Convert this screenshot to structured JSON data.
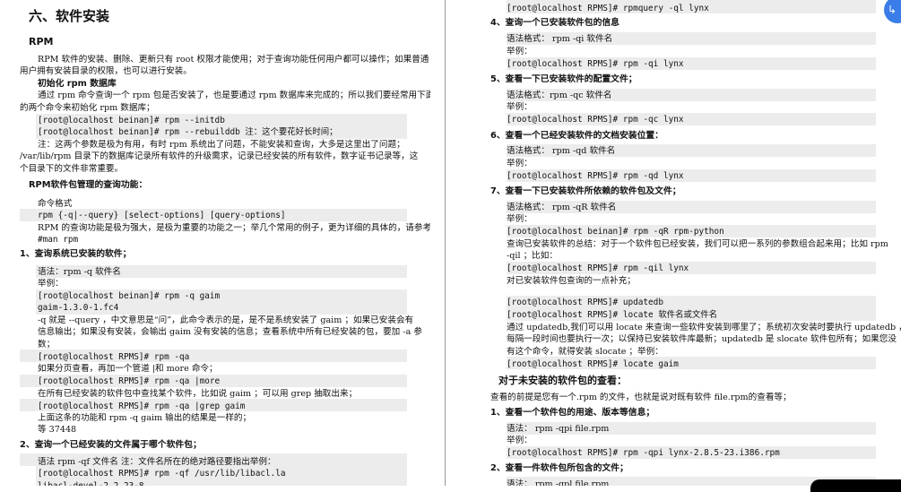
{
  "left_page": {
    "lines": [
      {
        "text": "六、软件安装",
        "style": "h1"
      },
      {
        "text": "RPM",
        "style": "h2"
      },
      {
        "text": "RPM 软件的安装、删除、更新只有 root 权限才能使用；对于查询功能任何用户都可以操作；如果普通",
        "style": "t"
      },
      {
        "text": "用户拥有安装目录的权限，也可以进行安装。",
        "style": "t"
      },
      {
        "text": "初始化 rpm 数据库",
        "style": "h3"
      },
      {
        "text": "通过 rpm 命令查询一个 rpm 包是否安装了，也是要通过 rpm 数据库来完成的；所以我们要经常用下面",
        "style": "t"
      },
      {
        "text": "的两个命令来初始化 rpm 数据库；",
        "style": "t"
      },
      {
        "text": "[root@localhost beinan]# rpm --initdb",
        "style": "code"
      },
      {
        "text": "[root@localhost beinan]# rpm --rebuilddb   注：这个要花好长时间；",
        "style": "code"
      },
      {
        "text": "注：这两个参数是极为有用，有时 rpm 系统出了问题，不能安装和查询，大多是这里出了问题；",
        "style": "t"
      },
      {
        "text": "/var/lib/rpm 目录下的数据库记录所有软件的升级需求，记录已经安装的所有软件，数字证书记录等，这",
        "style": "t"
      },
      {
        "text": "个目录下的文件非常重要。",
        "style": "t"
      },
      {
        "text": "RPM软件包管理的查询功能：",
        "style": "h3"
      },
      {
        "text": "命令格式",
        "style": "t"
      },
      {
        "text": "rpm {-q|--query} [select-options] [query-options]",
        "style": "code"
      },
      {
        "text": "RPM 的查询功能是极为强大，是极为重要的功能之一；举几个常用的例子，更为详细的具体的，请参考",
        "style": "t"
      },
      {
        "text": "#man rpm",
        "style": "code"
      },
      {
        "text": "1、查询系统已安装的软件；",
        "style": "h3"
      },
      {
        "text": "语法：rpm -q 软件名",
        "style": "t"
      },
      {
        "text": "举例：",
        "style": "t"
      },
      {
        "text": "[root@localhost beinan]# rpm  -q gaim",
        "style": "code"
      },
      {
        "text": "gaim-1.3.0-1.fc4",
        "style": "code"
      },
      {
        "text": "-q 就是 --query ，中文意思是“问”，此命令表示的是，是不是系统安装了 gaim ；如果已安装会有",
        "style": "t"
      },
      {
        "text": "信息输出；如果没有安装，会输出 gaim 没有安装的信息；查看系统中所有已经安装的包，要加 -a 参",
        "style": "t"
      },
      {
        "text": "数；",
        "style": "t"
      },
      {
        "text": "[root@localhost RPMS]# rpm -qa",
        "style": "code"
      },
      {
        "text": "如果分页查看，再加一个管道 |和 more 命令；",
        "style": "t"
      },
      {
        "text": "[root@localhost RPMS]# rpm -qa |more",
        "style": "code"
      },
      {
        "text": "在所有已经安装的软件包中查找某个软件，比如说 gaim ；可以用 grep 抽取出来；",
        "style": "t"
      },
      {
        "text": "[root@localhost RPMS]# rpm -qa |grep gaim",
        "style": "code"
      },
      {
        "text": "上面这条的功能和 rpm -q gaim 输出的结果是一样的；",
        "style": "t"
      },
      {
        "text": "等 37448",
        "style": "t"
      },
      {
        "text": "2、查询一个已经安装的文件属于哪个软件包；",
        "style": "h3"
      },
      {
        "text": "语法 rpm -qf 文件名  注：文件名所在的绝对路径要指出举例：",
        "style": "t"
      },
      {
        "text": "[root@localhost RPMS]# rpm -qf /usr/lib/libacl.la",
        "style": "code"
      },
      {
        "text": "libacl-devel-2.2.23-8",
        "style": "code"
      }
    ]
  },
  "right_page": {
    "lines": [
      {
        "text": "[root@localhost RPMS]# rpmquery -ql  lynx",
        "style": "code"
      },
      {
        "text": "4、查询一个已安装软件包的信息",
        "style": "h3"
      },
      {
        "text": "语法格式： rpm -qi 软件名",
        "style": "t"
      },
      {
        "text": "举例：",
        "style": "t"
      },
      {
        "text": "[root@localhost RPMS]# rpm -qi lynx",
        "style": "code"
      },
      {
        "text": "5、查看一下已安装软件的配置文件；",
        "style": "h3"
      },
      {
        "text": "语法格式：rpm -qc 软件名",
        "style": "t"
      },
      {
        "text": "举例：",
        "style": "t"
      },
      {
        "text": "[root@localhost RPMS]# rpm -qc lynx",
        "style": "code"
      },
      {
        "text": "6、查看一个已经安装软件的文档安装位置：",
        "style": "h3"
      },
      {
        "text": "语法格式： rpm -qd 软件名",
        "style": "t"
      },
      {
        "text": "举例：",
        "style": "t"
      },
      {
        "text": "[root@localhost RPMS]# rpm -qd lynx",
        "style": "code"
      },
      {
        "text": "7、查看一下已安装软件所依赖的软件包及文件；",
        "style": "h3"
      },
      {
        "text": "语法格式： rpm -qR 软件名",
        "style": "t"
      },
      {
        "text": "举例：",
        "style": "t"
      },
      {
        "text": "[root@localhost beinan]# rpm -qR  rpm-python",
        "style": "code"
      },
      {
        "text": "查询已安装软件的总结：对于一个软件包已经安装，我们可以把一系列的参数组合起来用；比如 rpm",
        "style": "t"
      },
      {
        "text": "-qil ；比如：",
        "style": "t"
      },
      {
        "text": "[root@localhost RPMS]# rpm -qil lynx",
        "style": "code"
      },
      {
        "text": "对已安装软件包查询的一点补充；",
        "style": "t"
      },
      {
        "text": "[root@localhost RPMS]# updatedb",
        "style": "code"
      },
      {
        "text": "[root@localhost RPMS]#  locate 软件名或文件名",
        "style": "code"
      },
      {
        "text": "通过 updatedb,我们可以用 locate 来查询一些软件安装到哪里了；系统初次安装时要执行 updatedb ，",
        "style": "t"
      },
      {
        "text": "每隔一段时间也要执行一次；以保持已安装软件库最新；updatedb 是 slocate 软件包所有；如果您没",
        "style": "t"
      },
      {
        "text": "有这个命令，就得安装 slocate ；举例：",
        "style": "t"
      },
      {
        "text": "[root@localhost RPMS]#  locate gaim",
        "style": "code"
      },
      {
        "text": "对于未安装的软件包的查看：",
        "style": "h2"
      },
      {
        "text": "查看的前提是您有一个.rpm 的文件，也就是说对既有软件 file.rpm的查看等；",
        "style": "t"
      },
      {
        "text": "1、查看一个软件包的用途、版本等信息；",
        "style": "h3"
      },
      {
        "text": "语法： rpm -qpi file.rpm",
        "style": "t"
      },
      {
        "text": "举例：",
        "style": "t"
      },
      {
        "text": "[root@localhost RPMS]# rpm -qpi lynx-2.8.5-23.i386.rpm",
        "style": "code"
      },
      {
        "text": "2、查看一件软件包所包含的文件；",
        "style": "h3"
      },
      {
        "text": "语法： rpm -qpl   file.rpm",
        "style": "t"
      }
    ]
  },
  "overlay": {
    "fab_icon": "translate-screenshot-icon",
    "fab_glyph": "↳",
    "accent": "#3b7de8"
  }
}
